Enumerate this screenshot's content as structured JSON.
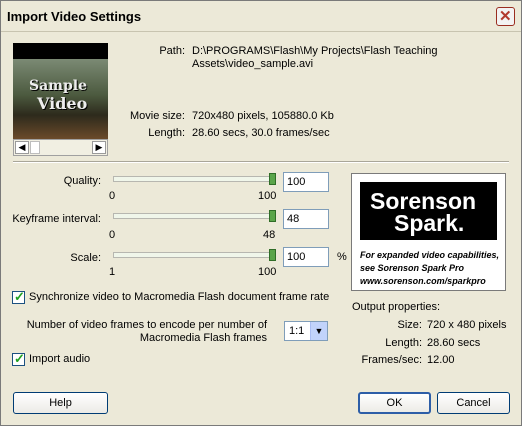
{
  "window": {
    "title": "Import Video Settings"
  },
  "preview": {
    "logo_text_1": "Sample",
    "logo_text_2": "Video"
  },
  "info": {
    "path_label": "Path:",
    "path_line1": "D:\\PROGRAMS\\Flash\\My Projects\\Flash Teaching",
    "path_line2": "Assets\\video_sample.avi",
    "movie_size_label": "Movie size:",
    "movie_size_value": "720x480 pixels, 105880.0 Kb",
    "length_label": "Length:",
    "length_value": "28.60 secs, 30.0 frames/sec"
  },
  "settings": {
    "quality": {
      "label": "Quality:",
      "min": "0",
      "max": "100",
      "value": "100",
      "level": 1.0
    },
    "keyframe": {
      "label": "Keyframe interval:",
      "min": "0",
      "max": "48",
      "value": "48",
      "level": 1.0
    },
    "scale": {
      "label": "Scale:",
      "min": "1",
      "max": "100",
      "value": "100",
      "unit": "%",
      "level": 1.0
    }
  },
  "sync": {
    "label": "Synchronize video to Macromedia Flash document frame rate",
    "checked": true
  },
  "frames": {
    "label_line1": "Number of video frames to encode per number of",
    "label_line2": "Macromedia Flash frames",
    "selected": "1:1"
  },
  "audio": {
    "label": "Import audio",
    "checked": true
  },
  "sorenson": {
    "brand_line1": "Sorenson",
    "brand_line2": "Spark.",
    "line1": "For expanded video capabilities,",
    "line2": "see Sorenson Spark Pro",
    "line3": "www.sorenson.com/sparkpro"
  },
  "output": {
    "title": "Output properties:",
    "size_label": "Size:",
    "size_value": "720 x 480 pixels",
    "length_label": "Length:",
    "length_value": "28.60 secs",
    "fps_label": "Frames/sec:",
    "fps_value": "12.00"
  },
  "buttons": {
    "help": "Help",
    "ok": "OK",
    "cancel": "Cancel"
  }
}
